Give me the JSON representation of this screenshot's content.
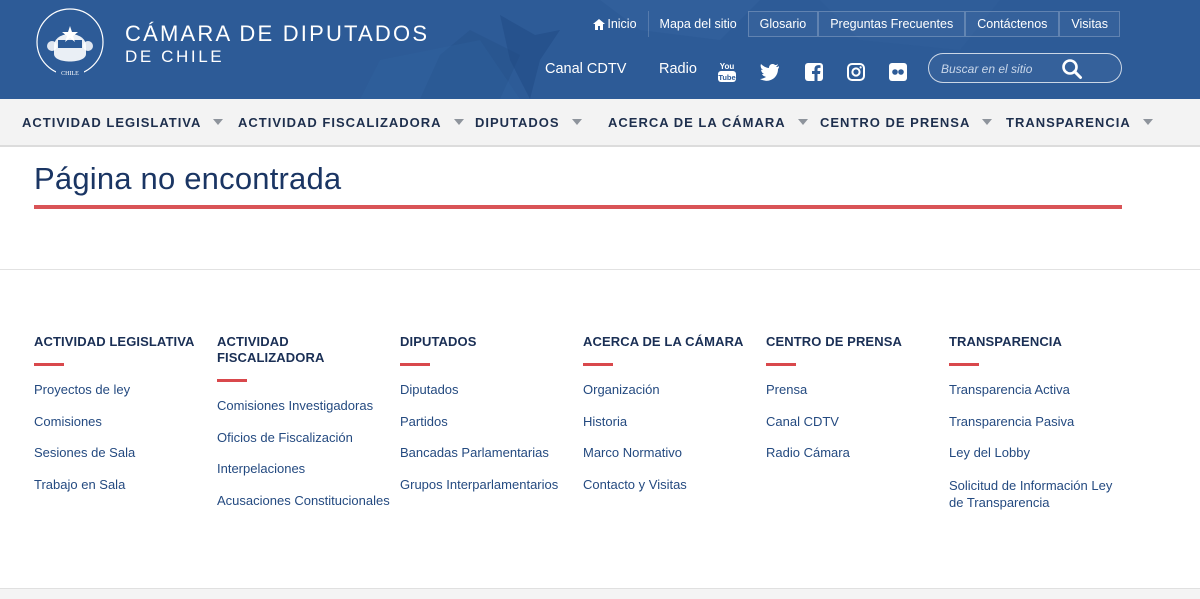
{
  "brand": {
    "title": "CÁMARA DE DIPUTADOS",
    "subtitle": "DE CHILE",
    "logo_text_top": "CAMARA DE DIPUTADOS",
    "logo_text_bottom": "CHILE"
  },
  "top_links": [
    {
      "label": "Inicio",
      "icon": "home-icon"
    },
    {
      "label": "Mapa del sitio"
    },
    {
      "label": "Glosario"
    },
    {
      "label": "Preguntas Frecuentes"
    },
    {
      "label": "Contáctenos"
    },
    {
      "label": "Visitas"
    }
  ],
  "media": {
    "canal": "Canal CDTV",
    "radio": "Radio",
    "social": [
      "youtube-icon",
      "twitter-icon",
      "facebook-icon",
      "instagram-icon",
      "flickr-icon"
    ],
    "youtube_top": "You",
    "youtube_bottom": "Tube"
  },
  "search": {
    "placeholder": "Buscar en el sitio",
    "icon": "search-icon"
  },
  "main_nav": [
    "ACTIVIDAD LEGISLATIVA",
    "ACTIVIDAD FISCALIZADORA",
    "DIPUTADOS",
    "ACERCA DE LA CÁMARA",
    "CENTRO DE PRENSA",
    "TRANSPARENCIA"
  ],
  "page": {
    "title": "Página no encontrada"
  },
  "footer": [
    {
      "heading": "ACTIVIDAD LEGISLATIVA",
      "links": [
        "Proyectos de ley",
        "Comisiones",
        "Sesiones de Sala",
        "Trabajo en Sala"
      ]
    },
    {
      "heading": "ACTIVIDAD FISCALIZADORA",
      "links": [
        "Comisiones Investigadoras",
        "Oficios de Fiscalización",
        "Interpelaciones",
        "Acusaciones Constitucionales"
      ]
    },
    {
      "heading": "DIPUTADOS",
      "links": [
        "Diputados",
        "Partidos",
        "Bancadas Parlamentarias",
        "Grupos Interparlamentarios"
      ]
    },
    {
      "heading": "ACERCA DE LA CÁMARA",
      "links": [
        "Organización",
        "Historia",
        "Marco Normativo",
        "Contacto y Visitas"
      ]
    },
    {
      "heading": "CENTRO DE PRENSA",
      "links": [
        "Prensa",
        "Canal CDTV",
        "Radio Cámara"
      ]
    },
    {
      "heading": "TRANSPARENCIA",
      "links": [
        "Transparencia Activa",
        "Transparencia Pasiva",
        "Ley del Lobby",
        "Solicitud de Información Ley de Transparencia"
      ]
    }
  ],
  "colors": {
    "header_bg": "#2d5b97",
    "accent_red": "#d95457",
    "nav_bg": "#f3f3f3",
    "title_blue": "#1a3563"
  }
}
